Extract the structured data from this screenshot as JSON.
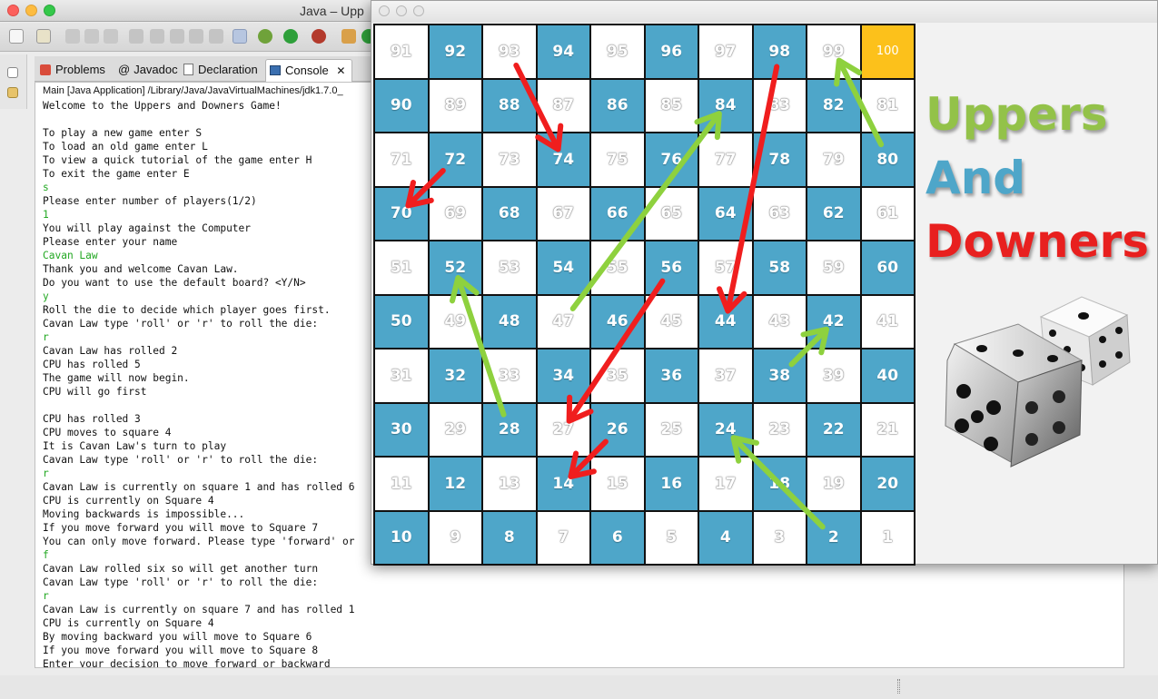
{
  "window": {
    "title": "Java – Upp"
  },
  "view_tabs": [
    {
      "label": "Problems"
    },
    {
      "label": "Javadoc"
    },
    {
      "label": "Declaration"
    },
    {
      "label": "Console"
    }
  ],
  "console": {
    "header": "Main [Java Application] /Library/Java/JavaVirtualMachines/jdk1.7.0_",
    "lines": [
      {
        "text": "Welcome to the Uppers and Downers Game!",
        "input": false
      },
      {
        "text": "",
        "input": false
      },
      {
        "text": "To play a new game enter S",
        "input": false
      },
      {
        "text": "To load an old game enter L",
        "input": false
      },
      {
        "text": "To view a quick tutorial of the game enter H",
        "input": false
      },
      {
        "text": "To exit the game enter E",
        "input": false
      },
      {
        "text": "s",
        "input": true
      },
      {
        "text": "Please enter number of players(1/2)",
        "input": false
      },
      {
        "text": "1",
        "input": true
      },
      {
        "text": "You will play against the Computer",
        "input": false
      },
      {
        "text": "Please enter your name",
        "input": false
      },
      {
        "text": "Cavan Law",
        "input": true
      },
      {
        "text": "Thank you and welcome Cavan Law.",
        "input": false
      },
      {
        "text": "Do you want to use the default board? <Y/N>",
        "input": false
      },
      {
        "text": "y",
        "input": true
      },
      {
        "text": "Roll the die to decide which player goes first.",
        "input": false
      },
      {
        "text": "Cavan Law type 'roll' or 'r' to roll the die:",
        "input": false
      },
      {
        "text": "r",
        "input": true
      },
      {
        "text": "Cavan Law has rolled 2",
        "input": false
      },
      {
        "text": "CPU has rolled 5",
        "input": false
      },
      {
        "text": "The game will now begin.",
        "input": false
      },
      {
        "text": "CPU will go first",
        "input": false
      },
      {
        "text": "",
        "input": false
      },
      {
        "text": "CPU has rolled 3",
        "input": false
      },
      {
        "text": "CPU moves to square 4",
        "input": false
      },
      {
        "text": "It is Cavan Law's turn to play",
        "input": false
      },
      {
        "text": "Cavan Law type 'roll' or 'r' to roll the die:",
        "input": false
      },
      {
        "text": "r",
        "input": true
      },
      {
        "text": "Cavan Law is currently on square 1 and has rolled 6",
        "input": false
      },
      {
        "text": "CPU is currently on Square 4",
        "input": false
      },
      {
        "text": "Moving backwards is impossible...",
        "input": false
      },
      {
        "text": "If you move forward you will move to Square 7",
        "input": false
      },
      {
        "text": "You can only move forward. Please type 'forward' or",
        "input": false
      },
      {
        "text": "f",
        "input": true
      },
      {
        "text": "Cavan Law rolled six so will get another turn",
        "input": false
      },
      {
        "text": "Cavan Law type 'roll' or 'r' to roll the die:",
        "input": false
      },
      {
        "text": "r",
        "input": true
      },
      {
        "text": "Cavan Law is currently on square 7 and has rolled 1",
        "input": false
      },
      {
        "text": "CPU is currently on Square 4",
        "input": false
      },
      {
        "text": "By moving backward you will move to Square 6",
        "input": false
      },
      {
        "text": "If you move forward you will move to Square 8",
        "input": false
      },
      {
        "text": "Enter your decision to move forward or backward",
        "input": false
      }
    ]
  },
  "game": {
    "logo": {
      "line1": "Uppers",
      "line2": "And",
      "line3": "Downers"
    },
    "colors": {
      "uppers": "#93c249",
      "and": "#4ea6c9",
      "downers": "#e8201f",
      "blue_square": "#4ea6c9",
      "finish_square": "#fcc11b",
      "up_arrow": "#8ed13e",
      "down_arrow": "#f01e1e"
    },
    "board": {
      "rows": [
        [
          91,
          92,
          93,
          94,
          95,
          96,
          97,
          98,
          99,
          100
        ],
        [
          90,
          89,
          88,
          87,
          86,
          85,
          84,
          83,
          82,
          81
        ],
        [
          71,
          72,
          73,
          74,
          75,
          76,
          77,
          78,
          79,
          80
        ],
        [
          70,
          69,
          68,
          67,
          66,
          65,
          64,
          63,
          62,
          61
        ],
        [
          51,
          52,
          53,
          54,
          55,
          56,
          57,
          58,
          59,
          60
        ],
        [
          50,
          49,
          48,
          47,
          46,
          45,
          44,
          43,
          42,
          41
        ],
        [
          31,
          32,
          33,
          34,
          35,
          36,
          37,
          38,
          39,
          40
        ],
        [
          30,
          29,
          28,
          27,
          26,
          25,
          24,
          23,
          22,
          21
        ],
        [
          11,
          12,
          13,
          14,
          15,
          16,
          17,
          18,
          19,
          20
        ],
        [
          10,
          9,
          8,
          7,
          6,
          5,
          4,
          3,
          2,
          1
        ]
      ],
      "uppers": [
        {
          "from": 28,
          "to": 52
        },
        {
          "from": 47,
          "to": 84
        },
        {
          "from": 80,
          "to": 99
        },
        {
          "from": 38,
          "to": 42
        },
        {
          "from": 2,
          "to": 24
        }
      ],
      "downers": [
        {
          "from": 93,
          "to": 74
        },
        {
          "from": 72,
          "to": 70
        },
        {
          "from": 98,
          "to": 44
        },
        {
          "from": 56,
          "to": 27
        },
        {
          "from": 26,
          "to": 14
        }
      ]
    }
  }
}
